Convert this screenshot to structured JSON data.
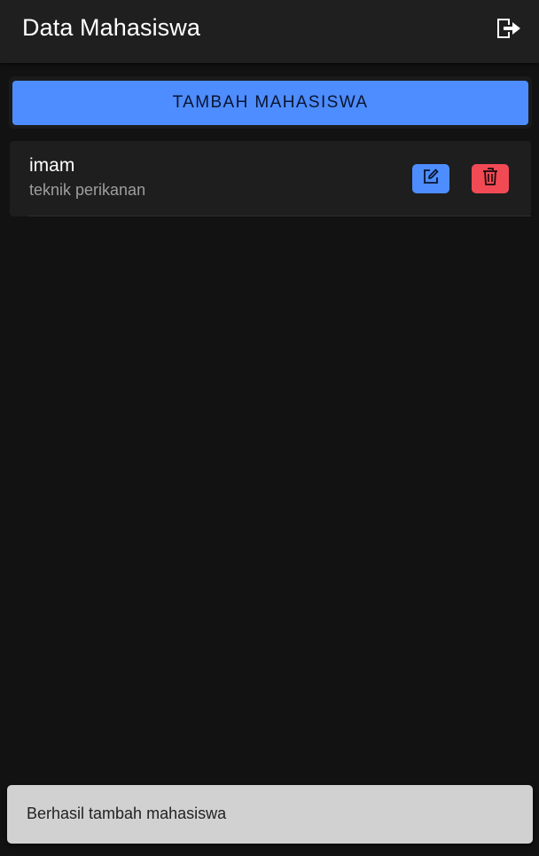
{
  "toolbar": {
    "title": "Data Mahasiswa",
    "logout_icon": "logout-icon"
  },
  "actions": {
    "add_label": "TAMBAH MAHASISWA"
  },
  "students": [
    {
      "name": "imam",
      "major": "teknik perikanan",
      "edit_icon": "edit-icon",
      "delete_icon": "trash-icon"
    }
  ],
  "toast": {
    "message": "Berhasil tambah mahasiswa"
  },
  "colors": {
    "background": "#121212",
    "toolbar": "#1f1f1f",
    "primary": "#4d8dff",
    "danger": "#f24a55",
    "toast": "#d1d1d1"
  }
}
